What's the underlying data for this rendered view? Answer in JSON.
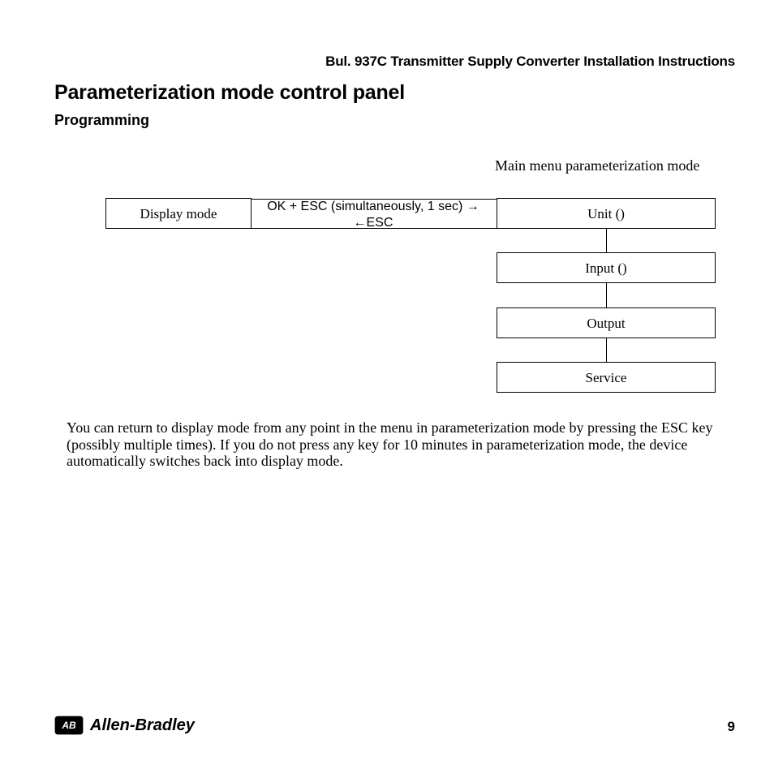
{
  "header": "Bul. 937C Transmitter Supply Converter Installation Instructions",
  "section_title": "Parameterization mode control panel",
  "subsection_title": "Programming",
  "menu_caption": "Main menu parameterization mode",
  "diagram": {
    "display_mode": "Display mode",
    "arrow_top": "OK + ESC (simultaneously, 1 sec) →",
    "arrow_bottom": "←ESC",
    "menu_items": [
      "Unit ()",
      "Input ()",
      "Output",
      "Service"
    ]
  },
  "paragraph": "You can return to display mode from any point in the menu in parameterization mode by pressing the ESC key (possibly multiple times). If you do not press any key for 10 minutes in parameterization mode, the device automatically switches back into display mode.",
  "footer": {
    "brand": "Allen-Bradley",
    "page_number": "9"
  }
}
